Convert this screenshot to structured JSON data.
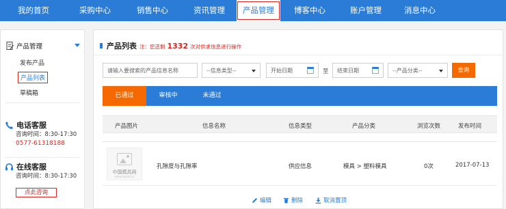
{
  "nav": {
    "items": [
      {
        "label": "我的首页"
      },
      {
        "label": "采购中心"
      },
      {
        "label": "销售中心"
      },
      {
        "label": "资讯管理"
      },
      {
        "label": "产品管理"
      },
      {
        "label": "博客中心"
      },
      {
        "label": "账户管理"
      },
      {
        "label": "消息中心"
      }
    ],
    "active_index": 4
  },
  "sidebar": {
    "section_title": "产品管理",
    "links": [
      {
        "label": "发布产品"
      },
      {
        "label": "产品列表"
      },
      {
        "label": "草稿箱"
      }
    ],
    "active_link_index": 1,
    "phone_service": {
      "title": "电话客服",
      "hours": "咨询时间：8:30-17:30",
      "phone": "0577-61318188"
    },
    "online_service": {
      "title": "在线客服",
      "hours": "咨询时间：8:30-17:30",
      "button": "点此咨询"
    }
  },
  "main": {
    "title": "产品列表",
    "note_prefix": "注：您还剩",
    "remaining": "1332",
    "note_suffix": "次对供求信息进行操作",
    "filters": {
      "search_placeholder": "请输入要搜索的产品信息名称",
      "info_type": "--信息类型--",
      "start_date": "开始日期",
      "to": "至",
      "end_date": "结束日期",
      "category": "--产品分类--",
      "search_button": "查询"
    },
    "tabs": [
      {
        "label": "已通过"
      },
      {
        "label": "审核中"
      },
      {
        "label": "未通过"
      }
    ],
    "active_tab_index": 0,
    "columns": [
      "产品图片",
      "信息名称",
      "信息类型",
      "产品分类",
      "浏览次数",
      "发布时间"
    ],
    "rows": [
      {
        "thumb_logo": "中国模具网",
        "thumb_url": "www.mould.cn",
        "name": "孔隙度与孔隙率",
        "type": "供应信息",
        "category": "模具 > 塑料模具",
        "views": "0次",
        "date": "2017-07-13",
        "actions": {
          "edit": "编辑",
          "delete": "删除",
          "unpin": "取消置顶"
        }
      }
    ],
    "colors": {
      "primary": "#2b7cd7",
      "accent": "#f56a00",
      "alert": "#d9251c"
    }
  }
}
